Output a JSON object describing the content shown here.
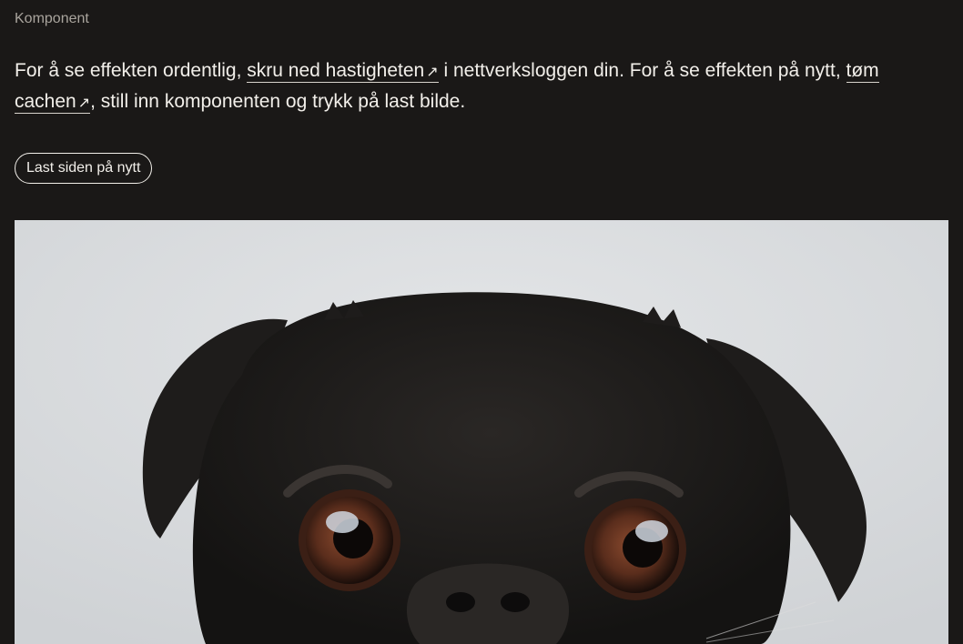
{
  "section": {
    "eyebrow": "Komponent"
  },
  "intro": {
    "text_1": "For å se effekten ordentlig, ",
    "link_1_label": "skru ned hastigheten",
    "link_1_arrow": "↗",
    "text_2": " i nettverksloggen din. For å se effekten på nytt, ",
    "link_2_label": "tøm cachen",
    "link_2_arrow": "↗",
    "text_3": ", still inn komponenten og trykk på last bilde."
  },
  "actions": {
    "reload_label": "Last siden på nytt"
  },
  "image": {
    "subject": "black pug puppy against light grey wall",
    "colors": {
      "background": "#d9dbdd",
      "fur": "#1c1a19",
      "eye": "#5a2d1c"
    }
  }
}
